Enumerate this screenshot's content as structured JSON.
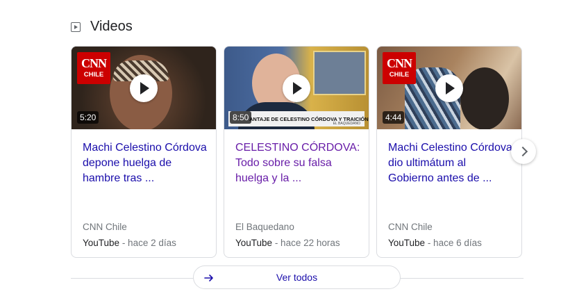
{
  "section": {
    "title": "Videos",
    "icon": "video-icon"
  },
  "cards": [
    {
      "title": "Machi Celestino Córdova depone huelga de hambre tras ...",
      "duration": "5:20",
      "logo_main": "CNN",
      "logo_sub": "CHILE",
      "source": "CNN Chile",
      "platform": "YouTube",
      "age": " - hace 2 días",
      "visited": false
    },
    {
      "title": "CELESTINO CÓRDOVA: Todo sobre su falsa huelga y la ...",
      "duration": "8:50",
      "ticker": "ANTAJE DE CELESTINO CÓRDOVA Y TRAICIÓN DEL GOBIERNO",
      "ticker_sub": "EL BAQUEDANO",
      "source": "El Baquedano",
      "platform": "YouTube",
      "age": " - hace 22 horas",
      "visited": true
    },
    {
      "title": "Machi Celestino Córdova dio ultimátum al Gobierno antes de ...",
      "duration": "4:44",
      "logo_main": "CNN",
      "logo_sub": "CHILE",
      "source": "CNN Chile",
      "platform": "YouTube",
      "age": " - hace 6 días",
      "visited": false
    }
  ],
  "see_all": {
    "label": "Ver todos"
  },
  "colors": {
    "link": "#1a0dab",
    "visited": "#681da8",
    "cnn_red": "#cc0000",
    "border": "#dadce0"
  }
}
